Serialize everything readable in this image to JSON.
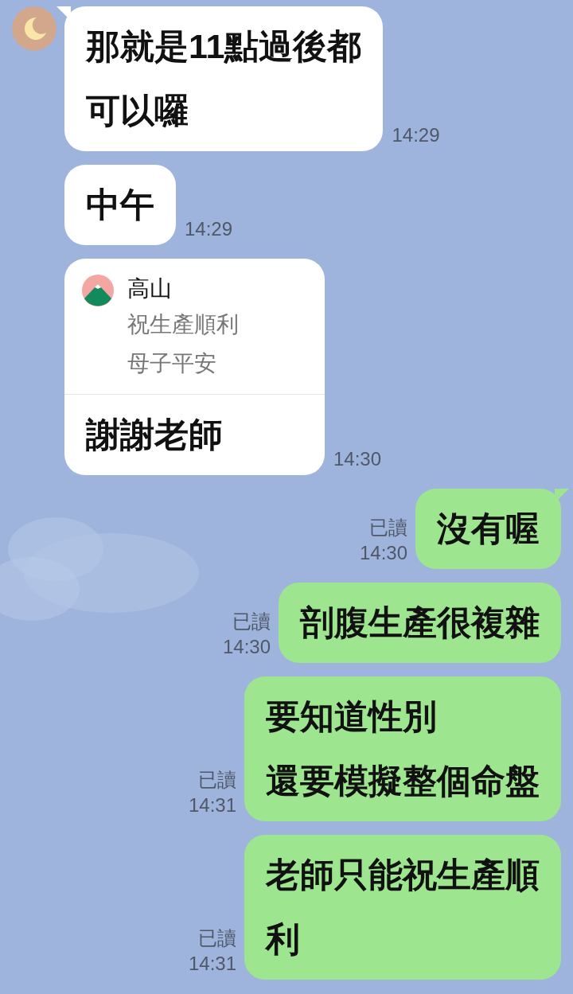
{
  "messages": [
    {
      "kind": "incoming",
      "show_avatar": true,
      "tail": true,
      "lines": [
        "那就是11點過後都",
        "可以囉"
      ],
      "time": "14:29"
    },
    {
      "kind": "incoming",
      "show_avatar": false,
      "tail": false,
      "lines": [
        "中午"
      ],
      "time": "14:29"
    },
    {
      "kind": "incoming_reply",
      "show_avatar": false,
      "tail": false,
      "quote": {
        "name": "高山",
        "lines": [
          "祝生產順利",
          "母子平安"
        ]
      },
      "lines": [
        "謝謝老師"
      ],
      "time": "14:30"
    },
    {
      "kind": "outgoing",
      "tail": true,
      "read": "已讀",
      "lines": [
        "沒有喔"
      ],
      "time": "14:30"
    },
    {
      "kind": "outgoing",
      "tail": false,
      "read": "已讀",
      "lines": [
        "剖腹生產很複雜"
      ],
      "time": "14:30"
    },
    {
      "kind": "outgoing",
      "tail": false,
      "read": "已讀",
      "lines": [
        "要知道性別",
        "還要模擬整個命盤"
      ],
      "time": "14:31"
    },
    {
      "kind": "outgoing",
      "tail": false,
      "read": "已讀",
      "lines": [
        "老師只能祝生產順",
        "利"
      ],
      "time": "14:31"
    }
  ]
}
